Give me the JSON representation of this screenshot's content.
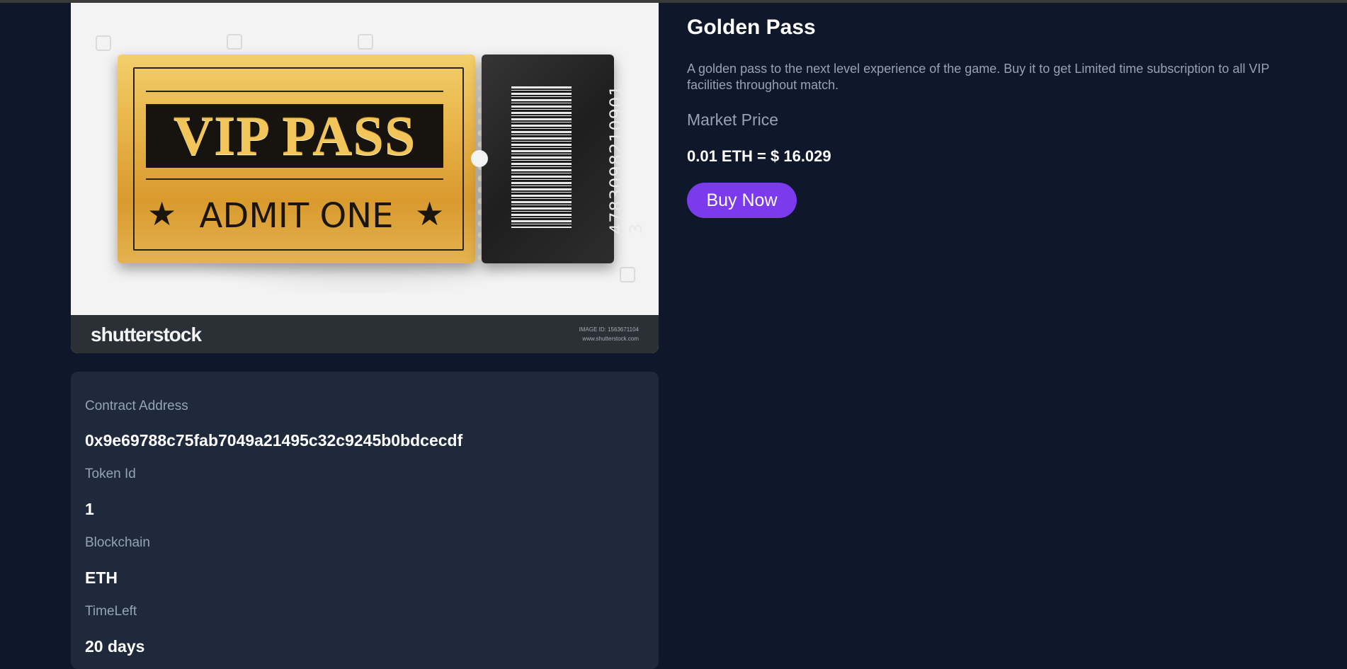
{
  "nft": {
    "title": "Golden Pass",
    "description": "A golden pass to the next level experience of the game. Buy it to get Limited time subscription to all VIP facilities throughout match.",
    "market_price_label": "Market Price",
    "market_price_value": "0.01 ETH = $ 16.029",
    "buy_label": "Buy Now"
  },
  "image": {
    "vip_text": "VIP PASS",
    "admit_text": "ADMIT ONE",
    "barcode_number": "4783098210901 3",
    "stock_brand": "shutterstock",
    "stock_meta_line1": "IMAGE ID: 1563671104",
    "stock_meta_line2": "www.shutterstock.com",
    "icon": "ticket-image"
  },
  "details": {
    "contract_label": "Contract Address",
    "contract_value": "0x9e69788c75fab7049a21495c32c9245b0bdcecdf",
    "token_label": "Token Id",
    "token_value": "1",
    "blockchain_label": "Blockchain",
    "blockchain_value": "ETH",
    "timeleft_label": "TimeLeft",
    "timeleft_value": "20 days"
  },
  "colors": {
    "page_background": "#0f172a",
    "card_background": "#1e293b",
    "accent": "#7c3aed",
    "muted_text": "#94a3b8"
  }
}
